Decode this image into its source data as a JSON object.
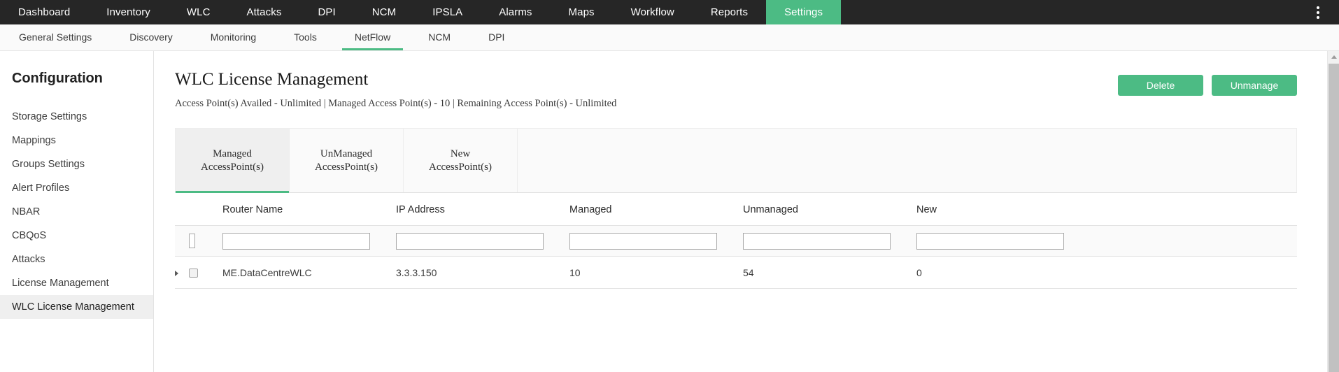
{
  "topnav": {
    "items": [
      {
        "label": "Dashboard",
        "active": false
      },
      {
        "label": "Inventory",
        "active": false
      },
      {
        "label": "WLC",
        "active": false
      },
      {
        "label": "Attacks",
        "active": false
      },
      {
        "label": "DPI",
        "active": false
      },
      {
        "label": "NCM",
        "active": false
      },
      {
        "label": "IPSLA",
        "active": false
      },
      {
        "label": "Alarms",
        "active": false
      },
      {
        "label": "Maps",
        "active": false
      },
      {
        "label": "Workflow",
        "active": false
      },
      {
        "label": "Reports",
        "active": false
      },
      {
        "label": "Settings",
        "active": true
      }
    ],
    "overflow_icon": "kebab-menu-icon",
    "active_color": "#4cbb84",
    "background": "#262626"
  },
  "subnav": {
    "items": [
      {
        "label": "General Settings",
        "active": false
      },
      {
        "label": "Discovery",
        "active": false
      },
      {
        "label": "Monitoring",
        "active": false
      },
      {
        "label": "Tools",
        "active": false
      },
      {
        "label": "NetFlow",
        "active": true
      },
      {
        "label": "NCM",
        "active": false
      },
      {
        "label": "DPI",
        "active": false
      }
    ],
    "active_color": "#4cbb84"
  },
  "sidebar": {
    "title": "Configuration",
    "items": [
      {
        "label": "Storage Settings",
        "active": false
      },
      {
        "label": "Mappings",
        "active": false
      },
      {
        "label": "Groups Settings",
        "active": false
      },
      {
        "label": "Alert Profiles",
        "active": false
      },
      {
        "label": "NBAR",
        "active": false
      },
      {
        "label": "CBQoS",
        "active": false
      },
      {
        "label": "Attacks",
        "active": false
      },
      {
        "label": "License Management",
        "active": false
      },
      {
        "label": "WLC License Management",
        "active": true
      }
    ]
  },
  "page": {
    "title": "WLC License Management",
    "subtitle": "Access Point(s) Availed - Unlimited | Managed Access Point(s) - 10 | Remaining Access Point(s) - Unlimited",
    "actions": {
      "delete_label": "Delete",
      "unmanage_label": "Unmanage"
    }
  },
  "tabs": [
    {
      "line1": "Managed",
      "line2": "AccessPoint(s)",
      "active": true
    },
    {
      "line1": "UnManaged",
      "line2": "AccessPoint(s)",
      "active": false
    },
    {
      "line1": "New",
      "line2": "AccessPoint(s)",
      "active": false
    }
  ],
  "table": {
    "columns": [
      "Router Name",
      "IP Address",
      "Managed",
      "Unmanaged",
      "New"
    ],
    "filters": {
      "router_name": "",
      "ip_address": "",
      "managed": "",
      "unmanaged": "",
      "new": ""
    },
    "rows": [
      {
        "selected": false,
        "router_name": "ME.DataCentreWLC",
        "ip_address": "3.3.3.150",
        "managed": "10",
        "unmanaged": "54",
        "new": "0"
      }
    ]
  },
  "scrollbar": {
    "up_arrow_icon": "chevron-up-icon"
  }
}
